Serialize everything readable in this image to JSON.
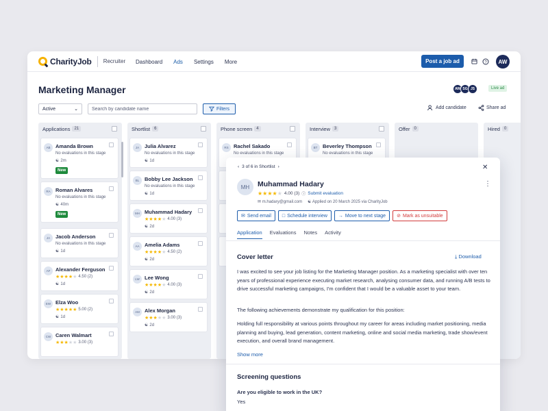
{
  "nav": {
    "logo_text": "CharityJob",
    "logo_sub": "Recruiter",
    "links": [
      "Dashboard",
      "Ads",
      "Settings",
      "More"
    ],
    "active_link": "Ads",
    "post_button": "Post a job ad",
    "user_initials": "AW"
  },
  "page": {
    "title": "Marketing Manager",
    "team": [
      "AW",
      "SG",
      "JS"
    ],
    "status": "Live ad"
  },
  "toolbar": {
    "status_select": "Active",
    "search_placeholder": "Search by candidate name",
    "filters": "Filters",
    "add_candidate": "Add candidate",
    "share_ad": "Share ad"
  },
  "columns": [
    {
      "title": "Applications",
      "count": "21"
    },
    {
      "title": "Shortlist",
      "count": "6"
    },
    {
      "title": "Phone screen",
      "count": "4"
    },
    {
      "title": "Interview",
      "count": "3"
    },
    {
      "title": "Offer",
      "count": "0"
    },
    {
      "title": "Hired",
      "count": "0"
    }
  ],
  "applications": [
    {
      "initials": "AB",
      "name": "Amanda Brown",
      "line": "No evaluations in this stage",
      "age": "2m",
      "badge": "New"
    },
    {
      "initials": "RA",
      "name": "Roman Alvares",
      "line": "No evaluations in this stage",
      "age": "40m",
      "badge": "New"
    },
    {
      "initials": "JA",
      "name": "Jacob Anderson",
      "line": "No evaluations in this stage",
      "age": "1d"
    },
    {
      "initials": "AF",
      "name": "Alexander Ferguson",
      "rating": "4.50 (2)",
      "stars": 4,
      "age": "1d"
    },
    {
      "initials": "EW",
      "name": "Elza Woo",
      "rating": "5.00 (2)",
      "stars": 5,
      "age": "1d"
    },
    {
      "initials": "CW",
      "name": "Caren Walmart",
      "rating": "3.00 (3)",
      "stars": 3,
      "age": ""
    }
  ],
  "shortlist": [
    {
      "initials": "JA",
      "name": "Julia Alvarez",
      "line": "No evaluations in this stage",
      "age": "1d"
    },
    {
      "initials": "BL",
      "name": "Bobby Lee Jackson",
      "line": "No evaluations in this stage",
      "age": "1d"
    },
    {
      "initials": "MH",
      "name": "Muhammad Hadary",
      "rating": "4.00 (3)",
      "stars": 4,
      "age": "2d"
    },
    {
      "initials": "AA",
      "name": "Amelia Adams",
      "rating": "4.50 (2)",
      "stars": 4,
      "age": "2d"
    },
    {
      "initials": "LW",
      "name": "Lee Wong",
      "rating": "4.00 (3)",
      "stars": 4,
      "age": "2d"
    },
    {
      "initials": "AM",
      "name": "Alex Morgan",
      "rating": "3.00 (3)",
      "stars": 3,
      "age": "2d"
    }
  ],
  "phone_screen": [
    {
      "initials": "RS",
      "name": "Rachel Sakado",
      "line": "No evaluations in this stage"
    }
  ],
  "interview": [
    {
      "initials": "BT",
      "name": "Beverley Thompson",
      "line": "No evaluations in this stage"
    }
  ],
  "panel": {
    "pager": "3 of 6 in Shortlist",
    "initials": "MH",
    "name": "Muhammad Hadary",
    "rating": "4.00 (3)",
    "stars": 4,
    "submit_evaluation": "Submit evaluation",
    "email": "m.hadary@gmail.com",
    "applied": "Applied on 20 March 2025 via CharityJob",
    "actions": {
      "send_email": "Send email",
      "schedule": "Schedule interview",
      "move": "Move to next stage",
      "unsuitable": "Mark as unsuitable"
    },
    "tabs": [
      "Application",
      "Evaluations",
      "Notes",
      "Activity"
    ],
    "cover_title": "Cover letter",
    "download": "Download",
    "para1": "I was excited to see your job listing for the Marketing Manager position. As a marketing specialist with over ten years of professional experience executing market research, analysing consumer data, and running A/B tests to drive successful marketing campaigns, I'm confident that I would be a valuable asset to your team.",
    "para2": "The following achievements demonstrate my qualification for this position:",
    "para3": "Holding full responsibility at various points throughout my career for areas including market positioning, media planning and buying, lead generation, content marketing, online and social media marketing, trade show/event execution, and overall brand management.",
    "show_more": "Show more",
    "screening_title": "Screening questions",
    "question": "Are you eligible to work in the UK?",
    "answer": "Yes"
  },
  "colors": {
    "primary": "#1c5cab",
    "star": "#f5b800",
    "new": "#1e8a3c",
    "danger": "#d23a3a"
  }
}
